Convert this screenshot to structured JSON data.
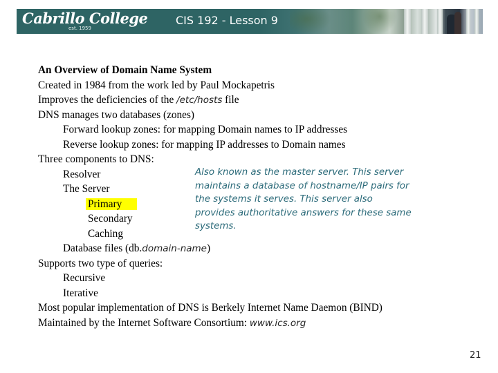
{
  "header": {
    "logo_text": "Cabrillo College",
    "logo_subtext": "est. 1959",
    "title": "CIS 192 - Lesson 9",
    "colors": {
      "banner_teal": "#2e6464"
    }
  },
  "slide": {
    "lines": [
      {
        "text": "An Overview of Domain Name System",
        "indent": 0,
        "bold": true
      },
      {
        "text": "Created in 1984 from the work led by Paul Mockapetris",
        "indent": 0
      },
      {
        "prefix": "Improves the deficiencies of the ",
        "italic": "/etc/hosts",
        "suffix": " file",
        "indent": 0
      },
      {
        "text": "DNS manages two databases (zones)",
        "indent": 0
      },
      {
        "text": "Forward lookup zones: for mapping Domain names to IP addresses",
        "indent": 1
      },
      {
        "text": "Reverse lookup zones: for mapping IP addresses to Domain names",
        "indent": 1
      },
      {
        "text": "Three components to DNS:",
        "indent": 0
      },
      {
        "text": "Resolver",
        "indent": 1
      },
      {
        "text": "The Server",
        "indent": 1
      },
      {
        "text": "Primary",
        "indent": 2,
        "highlighted": true
      },
      {
        "text": "Secondary",
        "indent": 2
      },
      {
        "text": "Caching",
        "indent": 2
      },
      {
        "prefix": "Database files (db.",
        "italic": "domain-name",
        "suffix": ")",
        "indent": 1
      },
      {
        "text": "Supports two type of queries:",
        "indent": 0
      },
      {
        "text": "Recursive",
        "indent": 1
      },
      {
        "text": "Iterative",
        "indent": 1
      },
      {
        "text": "Most popular implementation of DNS is Berkely Internet Name Daemon (BIND)",
        "indent": 0
      },
      {
        "prefix": "Maintained by the Internet Software Consortium: ",
        "italic": "www.ics.org",
        "suffix": "",
        "indent": 0
      }
    ],
    "highlight_color": "#ffff00",
    "callout": {
      "lines": [
        "Also known as the master server.  This server",
        "maintains a database of hostname/IP pairs for",
        "the systems it serves.  This server also",
        "provides authoritative answers for these same",
        "systems."
      ],
      "color": "#2c6b7a"
    },
    "page_number": "21"
  }
}
